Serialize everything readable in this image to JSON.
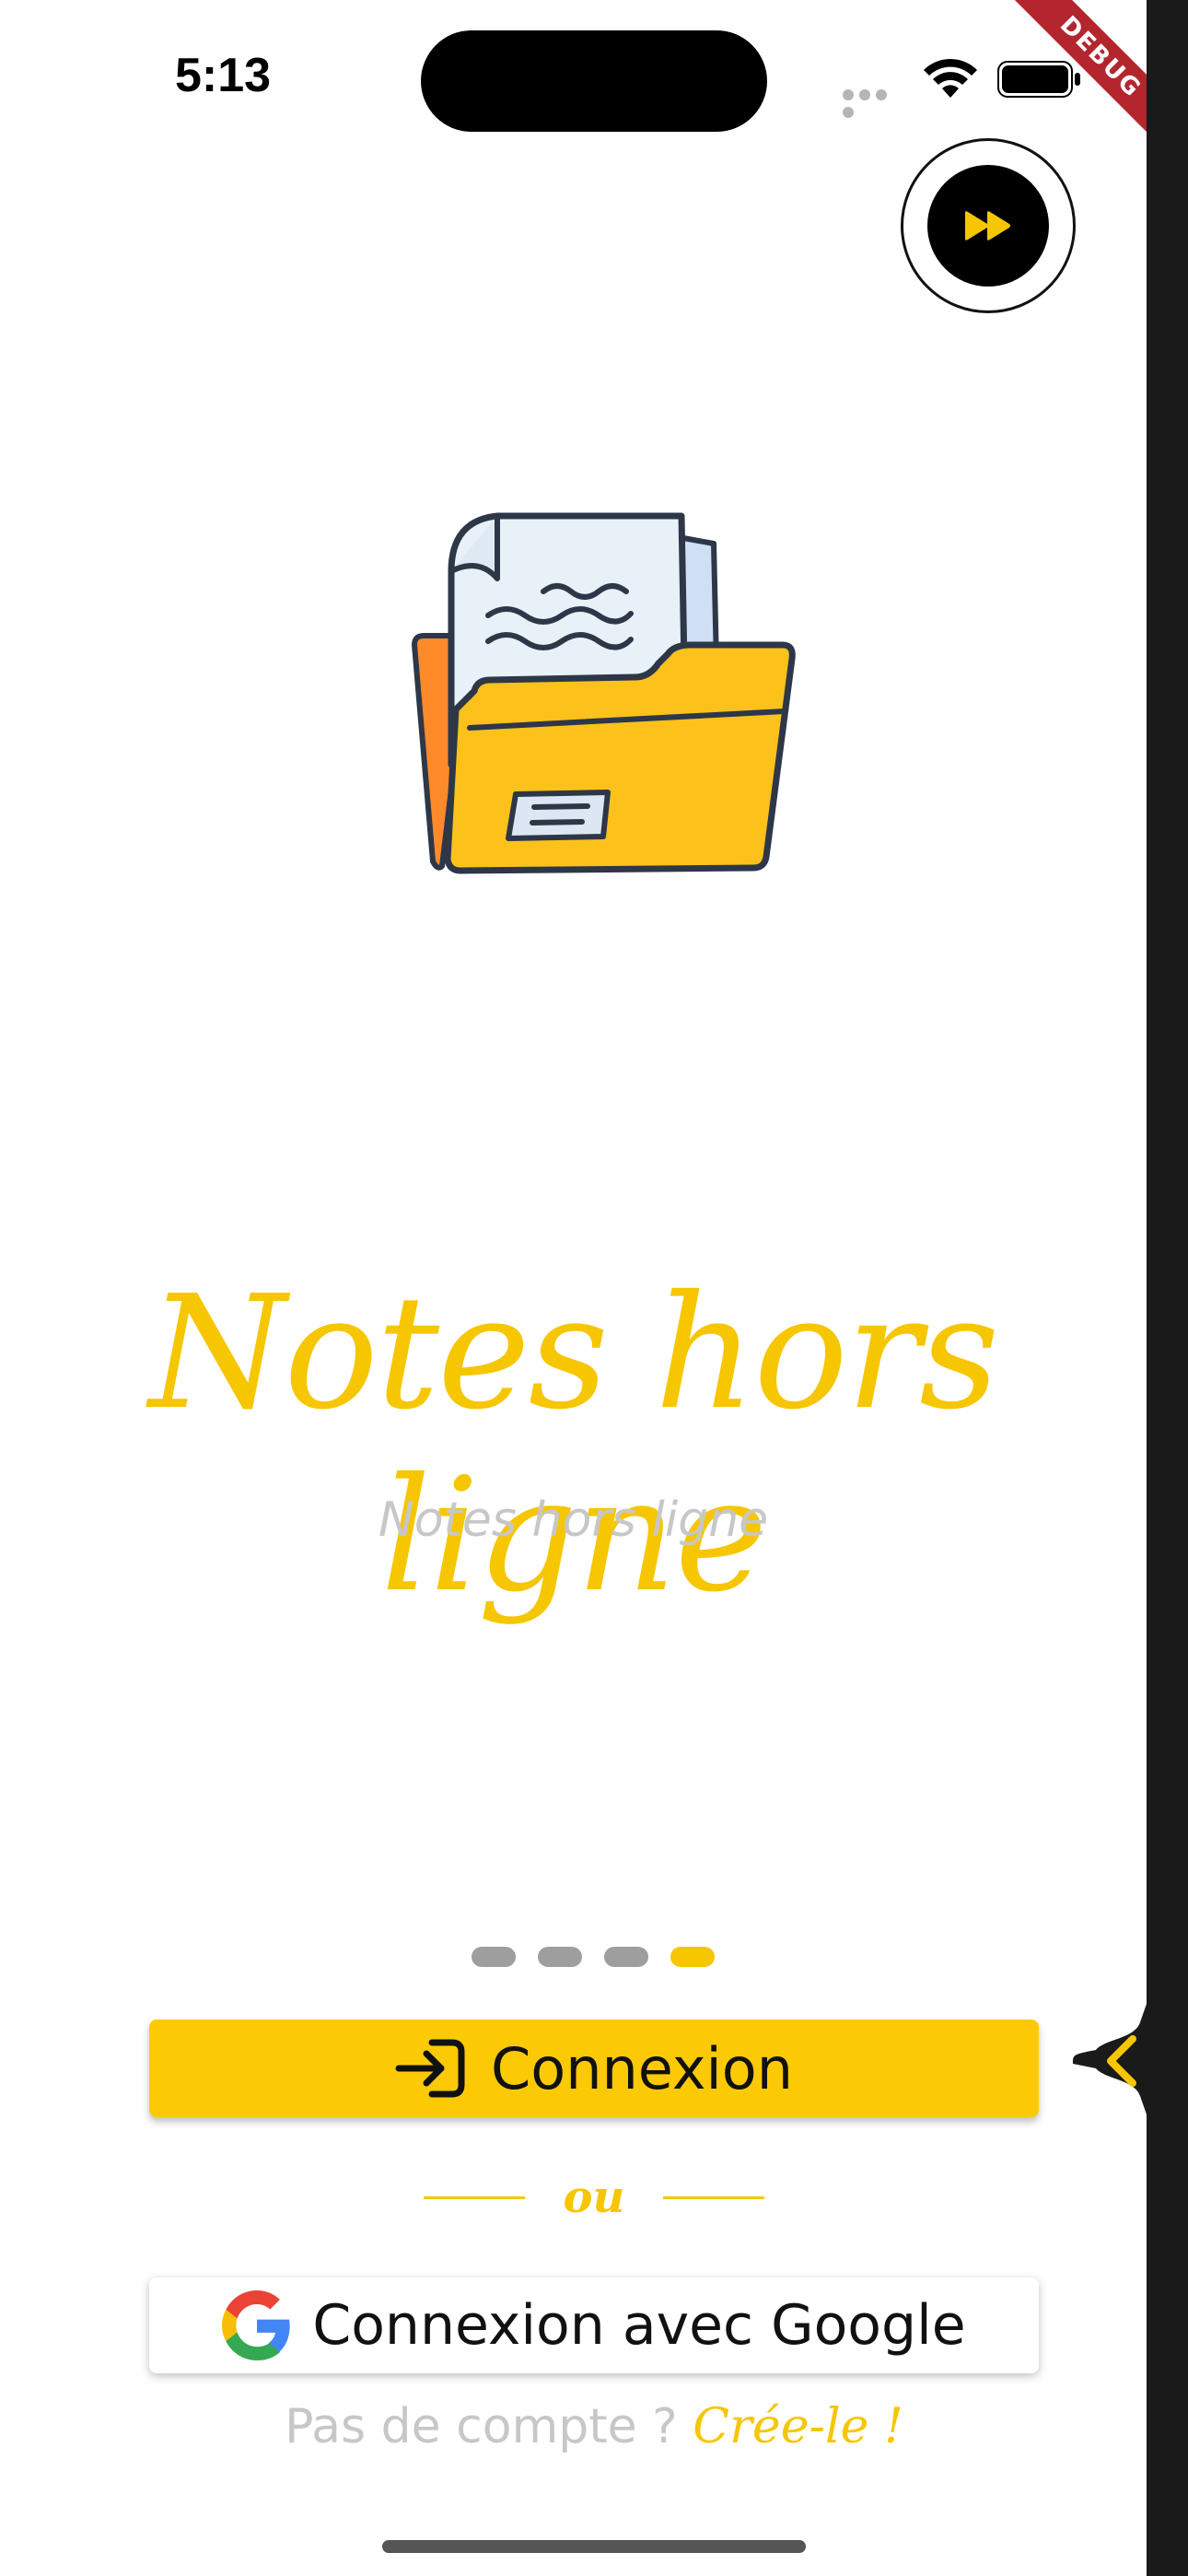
{
  "status_bar": {
    "time": "5:13"
  },
  "debug_ribbon": "DEBUG",
  "onboarding": {
    "title": "Notes hors ligne",
    "subtitle": "Notes hors ligne",
    "page_count": 4,
    "active_page": 4
  },
  "actions": {
    "login_label": "Connexion",
    "separator": "ou",
    "google_label": "Connexion avec Google",
    "signup_prompt": "Pas de compte ?",
    "signup_link": "Crée-le !"
  },
  "icons": {
    "skip": "fast-forward-icon",
    "login": "login-icon",
    "google": "google-logo-icon",
    "side_tab": "chevron-left-icon",
    "illustration": "folder-notes-illustration"
  },
  "colors": {
    "accent": "#fcca05",
    "title": "#f6c600",
    "muted": "#c7c7c7",
    "dot_inactive": "#9e9e9e"
  }
}
